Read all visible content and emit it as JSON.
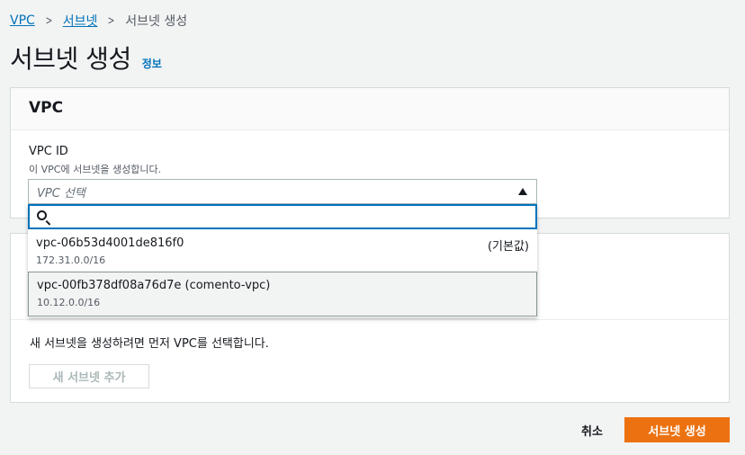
{
  "breadcrumb": {
    "items": [
      "VPC",
      "서브넷"
    ],
    "current": "서브넷 생성"
  },
  "page": {
    "title": "서브넷 생성",
    "info_link": "정보"
  },
  "vpc_panel": {
    "header": "VPC",
    "field_label": "VPC ID",
    "field_description": "이 VPC에 서브넷을 생성합니다.",
    "select_placeholder": "VPC 선택",
    "search_value": "",
    "options": [
      {
        "name": "vpc-06b53d4001de816f0",
        "cidr": "172.31.0.0/16",
        "tag": "(기본값)"
      },
      {
        "name": "vpc-00fb378df08a76d7e (comento-vpc)",
        "cidr": "10.12.0.0/16",
        "tag": ""
      }
    ]
  },
  "subnets_panel": {
    "message": "새 서브넷을 생성하려면 먼저 VPC를 선택합니다.",
    "add_button": "새 서브넷 추가"
  },
  "footer": {
    "cancel_label": "취소",
    "create_label": "서브넷 생성"
  },
  "colors": {
    "link": "#0073bb",
    "primary": "#ec7211",
    "focus": "#0073bb"
  }
}
